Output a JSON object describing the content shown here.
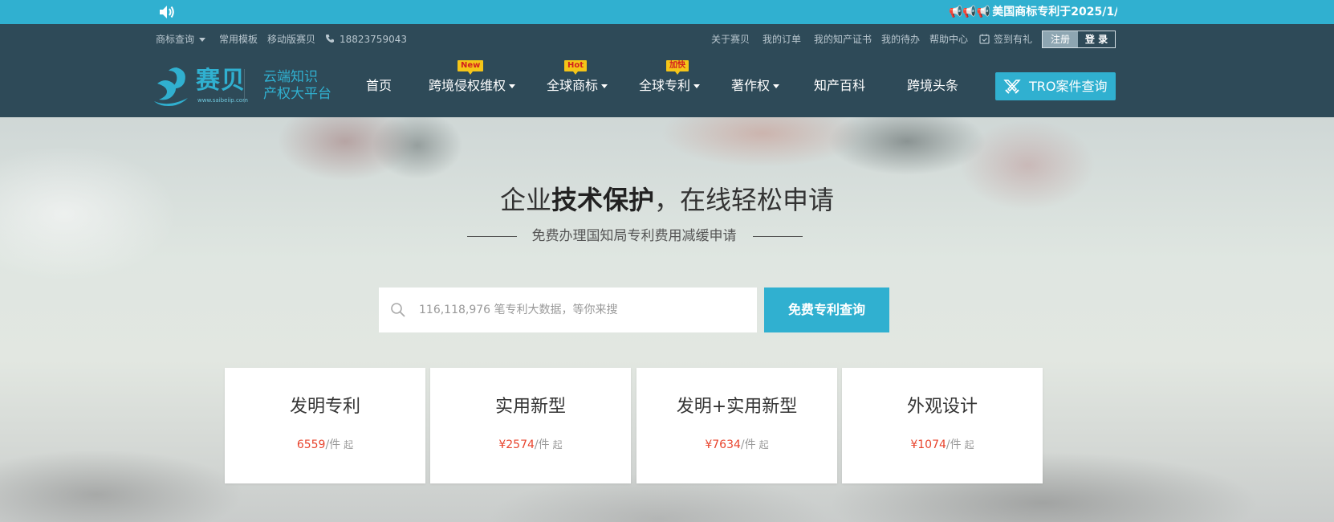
{
  "announcement": {
    "horns": "📢📢📢",
    "text": "美国商标专利于2025/1/"
  },
  "topbar": {
    "trademark_search": "商标查询",
    "templates": "常用模板",
    "mobile": "移动版赛贝",
    "phone": "18823759043",
    "links": [
      "关于赛贝",
      "我的订单",
      "我的知产证书",
      "我的待办",
      "帮助中心"
    ],
    "checkin": "签到有礼",
    "register": "注册",
    "login": "登 录"
  },
  "logo": {
    "name": "赛贝",
    "url": "www.saibeiip.com",
    "slogan_line1": "云端知识",
    "slogan_line2": "产权大平台"
  },
  "nav": {
    "home": "首页",
    "cross_border_rights": "跨境侵权维权",
    "global_trademark": "全球商标",
    "global_patent": "全球专利",
    "copyright": "著作权",
    "ip_wiki": "知产百科",
    "cross_border_news": "跨境头条",
    "badges": {
      "new": "New",
      "hot": "Hot",
      "fast": "加快"
    },
    "tro_button": "TRO案件查询"
  },
  "hero": {
    "title_prefix": "企业",
    "title_bold": "技术保护",
    "title_suffix": "，在线轻松申请",
    "subtitle": "免费办理国知局专利费用减缓申请",
    "search_placeholder": "116,118,976 笔专利大数据，等你来搜",
    "search_button": "免费专利查询"
  },
  "cards": [
    {
      "name": "发明专利",
      "amount": "6559",
      "unit": "/件",
      "from": "起"
    },
    {
      "name": "实用新型",
      "amount": "¥2574",
      "unit": "/件",
      "from": "起"
    },
    {
      "name": "发明+实用新型",
      "amount": "¥7634",
      "unit": "/件",
      "from": "起"
    },
    {
      "name": "外观设计",
      "amount": "¥1074",
      "unit": "/件",
      "from": "起"
    }
  ],
  "colors": {
    "accent": "#30b0d0",
    "header": "#2e4a58",
    "price": "#e8452e",
    "badge": "#f5c518"
  }
}
